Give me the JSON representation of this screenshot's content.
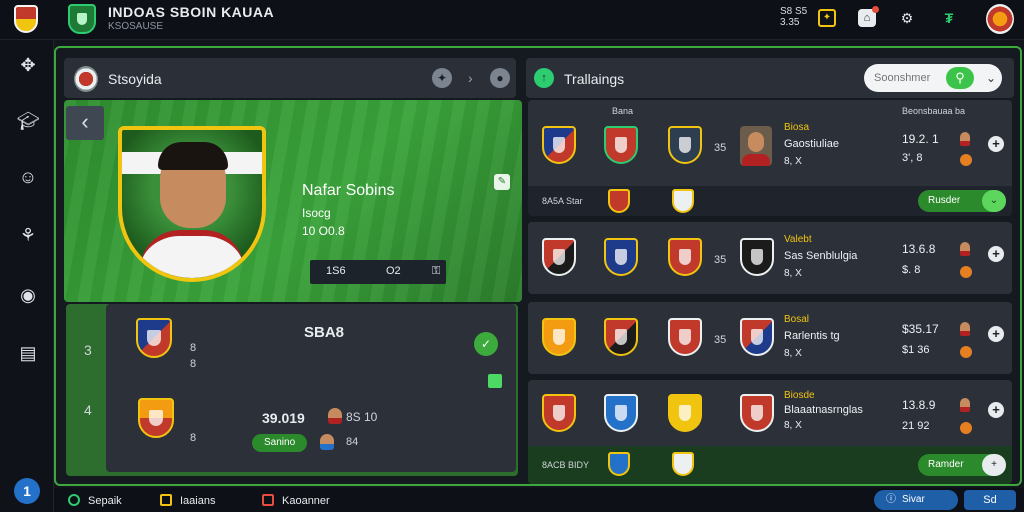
{
  "header": {
    "title": "INDOAS SBOIN KAUAA",
    "subtitle": "KSOSAUSE",
    "clock_top": "S8 S5",
    "clock_bottom": "3.35",
    "icons": [
      "shield-badge-icon",
      "notifications-icon",
      "gears-icon",
      "currency-icon"
    ]
  },
  "sidenav": {
    "items": [
      "tactics-icon",
      "academy-icon",
      "scouting-icon",
      "fitness-icon",
      "club-icon",
      "stats-icon"
    ],
    "help_label": "1"
  },
  "left_panel": {
    "head_label": "Stsoyida",
    "player": {
      "name": "Nafar Sobins",
      "line1": "Isocg",
      "line2": "10 O0.8",
      "stat_left": "1S6",
      "stat_right": "O2"
    },
    "lineup": {
      "title": "SBA8",
      "rows": [
        {
          "num": "3",
          "val1": "8",
          "val2": "8"
        },
        {
          "num": "4",
          "val1": "8"
        }
      ],
      "score": "39.019",
      "side_a": "8S 10",
      "side_b": "84",
      "button_label": "Sanino"
    }
  },
  "right_panel": {
    "head_label": "Trallaings",
    "search": {
      "placeholder": "Soonshmer"
    },
    "fixtures": [
      {
        "col_head_left": "Bana",
        "col_head_right": "Beonsbauaa ba",
        "mid": "35",
        "name1": "Biosa",
        "name2": "Gaostiuliae",
        "name3": "8, X",
        "score1": "19.2. 1",
        "score2": "3', 8",
        "footer_label": "8A5A Star",
        "action_label": "Rusder"
      },
      {
        "mid": "35",
        "name1": "Valebt",
        "name2": "Sas Senblulgia",
        "name3": "8, X",
        "score1": "13.6.8",
        "score2": "$. 8"
      },
      {
        "mid": "35",
        "name1": "Bosal",
        "name2": "Rarlentis tg",
        "name3": "8, X",
        "score1": "$35.17",
        "score2": "$1 36"
      },
      {
        "mid": "",
        "name1": "Biosde",
        "name2": "Blaaatnasrnglas",
        "name3": "8, X",
        "score1": "13.8.9",
        "score2": "21 92",
        "footer_label": "8ACB BIDY",
        "action_label": "Ramder"
      }
    ]
  },
  "bottombar": {
    "tab1": "Sepaik",
    "tab2": "Iaaians",
    "tab3": "Kaoanner",
    "sim_label": "Sivar",
    "sim_right": "Sd"
  },
  "colors": {
    "accent_green": "#3aa43a",
    "panel": "#2b3039",
    "background": "#12151c",
    "gold": "#f1c40f",
    "blue": "#1f5fa8"
  }
}
